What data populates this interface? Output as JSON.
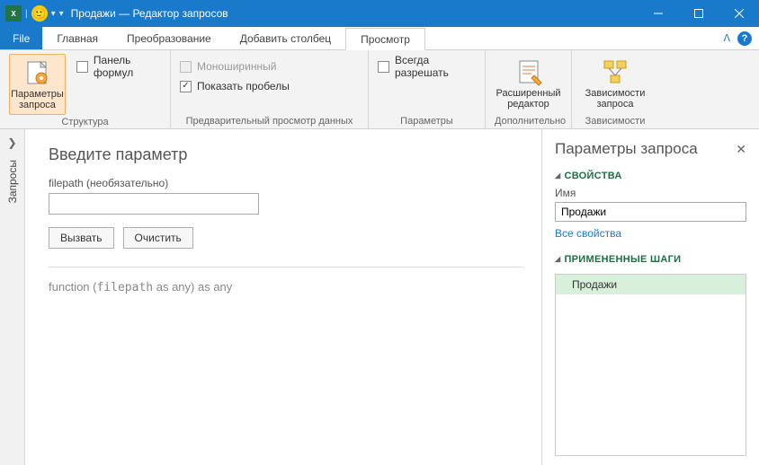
{
  "titlebar": {
    "title": "Продажи — Редактор запросов",
    "excel_abbrev": "X",
    "dropdown_glyph": "▾"
  },
  "tabs": {
    "file": "File",
    "items": [
      "Главная",
      "Преобразование",
      "Добавить столбец",
      "Просмотр"
    ],
    "active_index": 3,
    "collapse_glyph": "ᐱ",
    "help_glyph": "?"
  },
  "ribbon": {
    "groups": {
      "structure": {
        "label": "Структура",
        "query_params_btn": "Параметры\nзапроса",
        "formula_bar": "Панель формул"
      },
      "preview": {
        "label": "Предварительный просмотр данных",
        "monospaced": "Моноширинный",
        "show_whitespace": "Показать пробелы"
      },
      "parameters": {
        "label": "Параметры",
        "always_allow": "Всегда разрешать"
      },
      "advanced": {
        "label": "Дополнительно",
        "advanced_editor": "Расширенный\nредактор"
      },
      "dependencies": {
        "label": "Зависимости",
        "query_deps": "Зависимости\nзапроса"
      }
    }
  },
  "left_rail": {
    "chevron": "❯",
    "label": "Запросы"
  },
  "main": {
    "heading": "Введите параметр",
    "param_label": "filepath (необязательно)",
    "param_value": "",
    "invoke_btn": "Вызвать",
    "clear_btn": "Очистить",
    "signature_prefix": "function (",
    "signature_param": "filepath",
    "signature_mid": " as any)",
    "signature_suffix": " as any"
  },
  "right_pane": {
    "title": "Параметры запроса",
    "close_glyph": "✕",
    "properties_title": "СВОЙСТВА",
    "name_label": "Имя",
    "name_value": "Продажи",
    "all_props_link": "Все свойства",
    "steps_title": "ПРИМЕНЕННЫЕ ШАГИ",
    "steps": [
      "Продажи"
    ]
  }
}
